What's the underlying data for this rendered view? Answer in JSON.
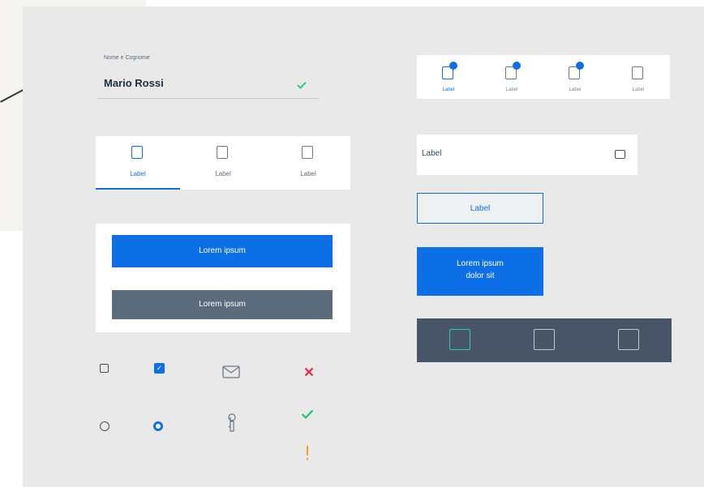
{
  "text_field": {
    "label": "Nome e Cognome",
    "value": "Mario Rossi",
    "check_icon": "check-icon"
  },
  "tabs": {
    "items": [
      {
        "label": "Label",
        "active": true
      },
      {
        "label": "Label",
        "active": false
      },
      {
        "label": "Label",
        "active": false
      }
    ]
  },
  "buttons": {
    "primary_label": "Lorem ipsum",
    "secondary_label": "Lorem ipsum"
  },
  "bottom_nav": {
    "items": [
      {
        "label": "Label",
        "badge": true,
        "active": true
      },
      {
        "label": "Label",
        "badge": true,
        "active": false
      },
      {
        "label": "Label",
        "badge": true,
        "active": false
      },
      {
        "label": "Label",
        "badge": false,
        "active": false
      }
    ]
  },
  "list_item": {
    "label": "Label"
  },
  "outline_button": {
    "label": "Label"
  },
  "big_button": {
    "line1": "Lorem ipsum",
    "line2": "dolor sit"
  },
  "dark_nav": {
    "items": [
      {
        "active": true
      },
      {
        "active": false
      },
      {
        "active": false
      }
    ]
  },
  "colors": {
    "primary": "#0d6fe6",
    "secondary": "#5c6b7c",
    "success": "#1fc86e",
    "danger": "#e8283d",
    "warning": "#f4a01a",
    "dark_bar": "#485566",
    "accent_teal": "#2fc7b6"
  },
  "icons": {
    "checkbox_empty": "checkbox-empty-icon",
    "checkbox_checked": "checkbox-checked-icon",
    "radio_empty": "radio-empty-icon",
    "radio_checked": "radio-checked-icon",
    "mail": "mail-icon",
    "touch": "touch-icon",
    "close": "close-icon",
    "check": "check-icon",
    "alert": "alert-icon"
  }
}
